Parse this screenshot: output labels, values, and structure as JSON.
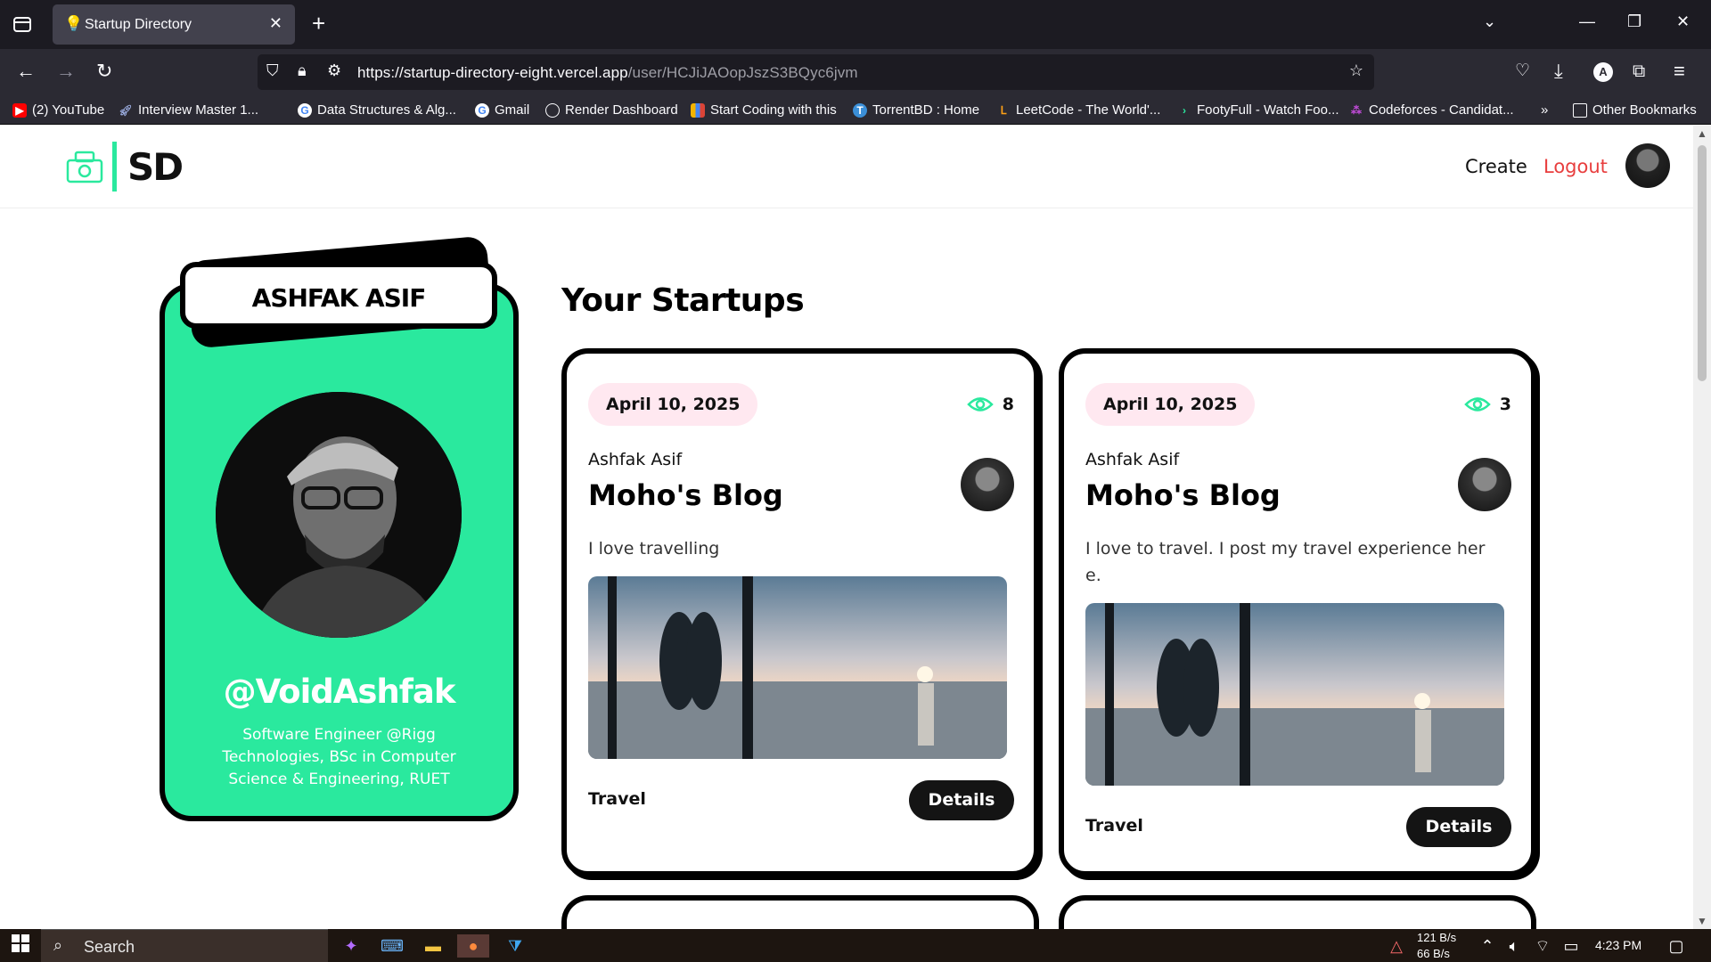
{
  "browser": {
    "tab_title": "Startup Directory",
    "url_host": "https://startup-directory-eight.vercel.app",
    "url_path": "/user/HCJiJAOopJszS3BQyc6jvm",
    "bookmarks": [
      "(2) YouTube",
      "Interview Master 1...",
      "Data Structures & Alg...",
      "Gmail",
      "Render Dashboard",
      "Start Coding with this",
      "TorrentBD : Home",
      "LeetCode - The World'...",
      "FootyFull - Watch Foo...",
      "Codeforces - Candidat..."
    ],
    "other_bookmarks": "Other Bookmarks"
  },
  "site": {
    "logo_text": "SD",
    "nav_create": "Create",
    "nav_logout": "Logout",
    "accent_color": "#2ae99e",
    "logout_color": "#e83e3e"
  },
  "profile": {
    "name": "ASHFAK ASIF",
    "handle": "@VoidAshfak",
    "bio": "Software Engineer @Rigg Technologies, BSc in Computer Science & Engineering, RUET"
  },
  "section_title": "Your Startups",
  "startups": [
    {
      "date": "April 10, 2025",
      "views": "8",
      "author": "Ashfak Asif",
      "title": "Moho's Blog",
      "description": "I love travelling",
      "category": "Travel",
      "details_label": "Details"
    },
    {
      "date": "April 10, 2025",
      "views": "3",
      "author": "Ashfak Asif",
      "title": "Moho's Blog",
      "description": "I love to travel. I post my travel experience her e.",
      "category": "Travel",
      "details_label": "Details"
    }
  ],
  "taskbar": {
    "search": "Search",
    "net_up": "121 B/s",
    "net_down": "66 B/s",
    "time": "4:23 PM"
  }
}
